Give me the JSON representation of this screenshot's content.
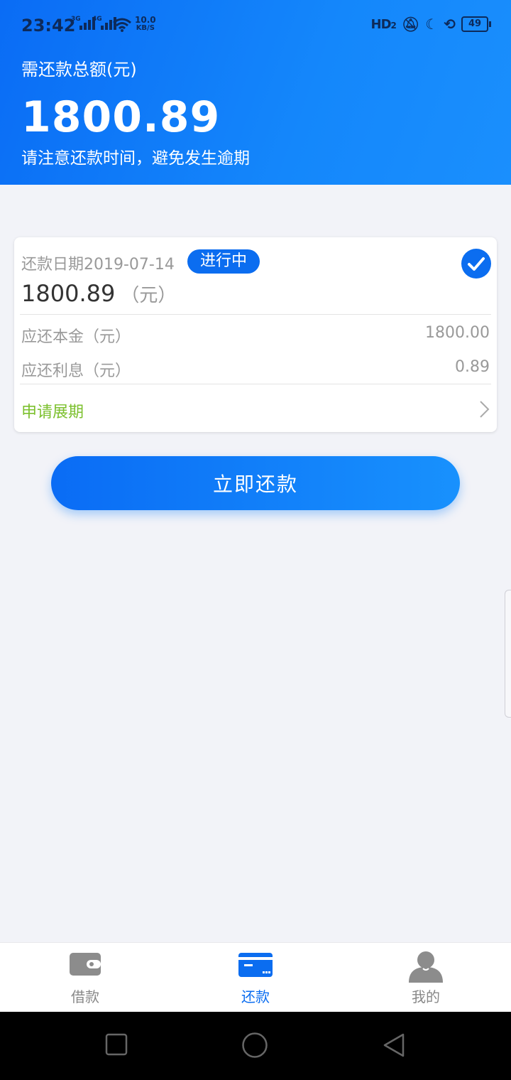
{
  "status_bar": {
    "time": "23:42",
    "signal1_label": "3G",
    "signal2_label": "4G",
    "net_speed_value": "10.0",
    "net_speed_unit": "KB/S",
    "hd_label": "HD",
    "hd_sub": "2",
    "battery": "49"
  },
  "header": {
    "total_label": "需还款总额(元)",
    "total_amount": "1800.89",
    "note": "请注意还款时间，避免发生逾期"
  },
  "card": {
    "due_date": "还款日期2019-07-14",
    "status": "进行中",
    "amount": "1800.89",
    "amount_unit": "（元）",
    "principal_label": "应还本金（元）",
    "principal_value": "1800.00",
    "interest_label": "应还利息（元）",
    "interest_value": "0.89",
    "extend_label": "申请展期"
  },
  "repay_button": "立即还款",
  "tabs": [
    {
      "label": "借款",
      "icon": "wallet-icon",
      "active": false
    },
    {
      "label": "还款",
      "icon": "card-icon",
      "active": true
    },
    {
      "label": "我的",
      "icon": "person-icon",
      "active": false
    }
  ],
  "colors": {
    "primary": "#0b6df0",
    "accent_green": "#7cc02e",
    "background": "#f2f3f8"
  }
}
